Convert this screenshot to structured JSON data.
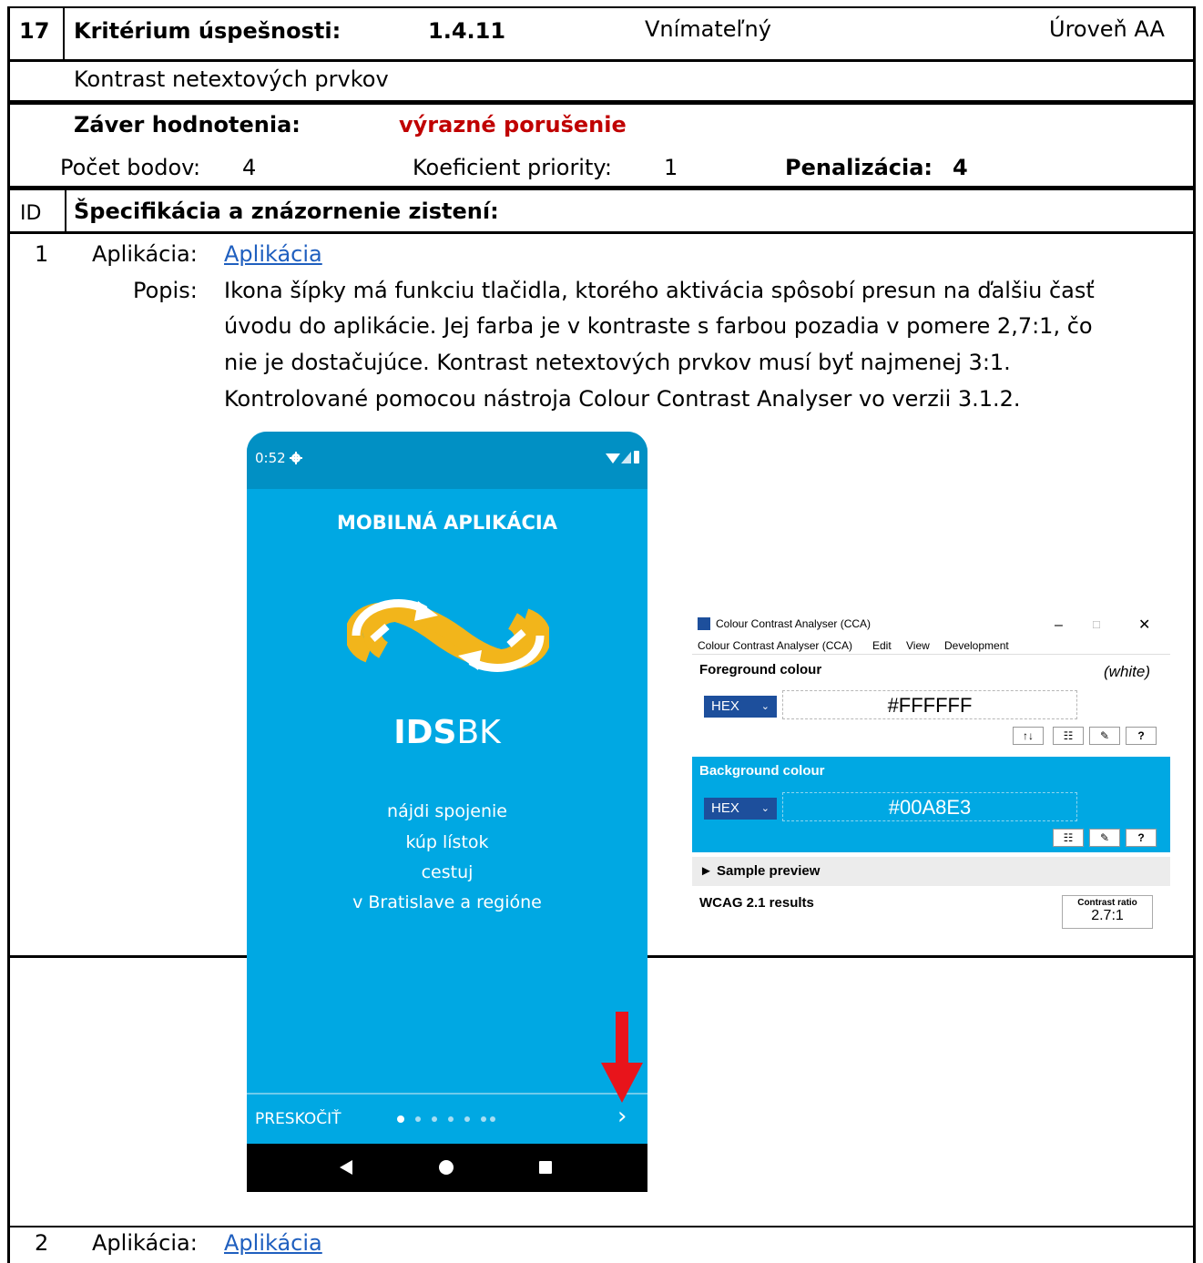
{
  "header": {
    "number": "17",
    "criterion_label": "Kritérium úspešnosti:",
    "criterion_id": "1.4.11",
    "principle": "Vnímateľný",
    "level": "Úroveň AA",
    "criterion_name": "Kontrast netextových prvkov"
  },
  "evaluation": {
    "verdict_label": "Záver hodnotenia:",
    "verdict_value": "výrazné porušenie",
    "verdict_color": "#c00000",
    "points_label": "Počet bodov:",
    "points_value": "4",
    "priority_label": "Koeficient priority:",
    "priority_value": "1",
    "penalty_label": "Penalizácia:",
    "penalty_value": "4"
  },
  "findings": {
    "id_header": "ID",
    "title": "Špecifikácia a znázornenie zistení:",
    "items": [
      {
        "id": "1",
        "app_label": "Aplikácia:",
        "app_link": "Aplikácia",
        "desc_label": "Popis:",
        "desc_lines": [
          "Ikona šípky má funkciu tlačidla, ktorého aktivácia spôsobí presun na ďalšiu časť",
          "úvodu do aplikácie. Jej farba je v kontraste s farbou pozadia v pomere 2,7:1, čo",
          "nie je dostačujúce. Kontrast netextových prvkov musí byť najmenej 3:1.",
          "Kontrolované pomocou nástroja Colour Contrast Analyser vo verzii 3.1.2."
        ]
      },
      {
        "id": "2",
        "app_label": "Aplikácia:",
        "app_link": "Aplikácia"
      }
    ]
  },
  "phone": {
    "time": "0:52",
    "title": "MOBILNÁ APLIKÁCIA",
    "logo_bold": "IDS",
    "logo_light": "BK",
    "tagline": [
      "nájdi spojenie",
      "kúp lístok",
      "cestuj",
      "v Bratislave a regióne"
    ],
    "skip_label": "PRESKOČIŤ",
    "next_icon": "›",
    "background_color": "#00A8E3"
  },
  "cca": {
    "window_title": "Colour Contrast Analyser (CCA)",
    "menu": [
      "Colour Contrast Analyser (CCA)",
      "Edit",
      "View",
      "Development"
    ],
    "foreground_label": "Foreground colour",
    "foreground_name": "(white)",
    "foreground_format": "HEX",
    "foreground_value": "#FFFFFF",
    "background_label": "Background colour",
    "background_format": "HEX",
    "background_value": "#00A8E3",
    "sample_preview": "► Sample preview",
    "results_label": "WCAG 2.1 results",
    "contrast_ratio_label": "Contrast ratio",
    "contrast_ratio_value": "2.7:1"
  }
}
